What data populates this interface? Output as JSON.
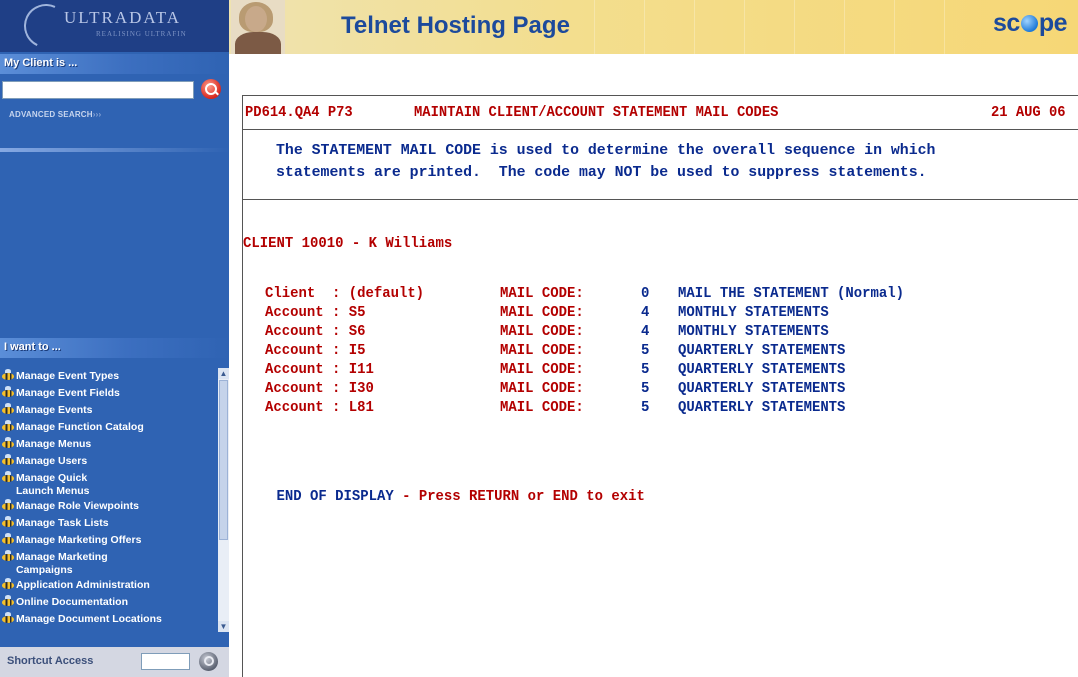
{
  "sidebar": {
    "logo": {
      "brand": "ULTRADATA",
      "tagline": "REALISING ULTRAFIN"
    },
    "client_section": {
      "title": "My Client is ..."
    },
    "client_search": {
      "value": "",
      "placeholder": ""
    },
    "advanced_search": {
      "label": "ADVANCED SEARCH",
      "arrows": "›››"
    },
    "i_want_to": {
      "title": "I want to ..."
    },
    "menu_items": [
      {
        "label": "Manage Event Types"
      },
      {
        "label": "Manage Event Fields"
      },
      {
        "label": "Manage Events"
      },
      {
        "label": "Manage Function Catalog"
      },
      {
        "label": "Manage Menus"
      },
      {
        "label": "Manage Users"
      },
      {
        "label": "Manage Quick Launch Menus"
      },
      {
        "label": "Manage Role Viewpoints"
      },
      {
        "label": "Manage Task Lists"
      },
      {
        "label": "Manage Marketing Offers"
      },
      {
        "label": "Manage Marketing Campaigns"
      },
      {
        "label": "Application Administration"
      },
      {
        "label": "Online Documentation"
      },
      {
        "label": "Manage Document Locations"
      }
    ],
    "shortcut": {
      "label": "Shortcut Access",
      "value": ""
    }
  },
  "banner": {
    "title": "Telnet Hosting Page",
    "logo_left": "sc",
    "logo_right": "pe"
  },
  "terminal": {
    "program_id": "PD614.QA4 P73",
    "screen_title": "MAINTAIN CLIENT/ACCOUNT STATEMENT MAIL CODES",
    "date": "21 AUG 06",
    "intro_line1": "The STATEMENT MAIL CODE is used to determine the overall sequence in which",
    "intro_line2": "statements are printed.  The code may NOT be used to suppress statements.",
    "client_line": "CLIENT 10010 - K Williams",
    "rows": [
      {
        "entity": "Client  : (default)",
        "code_label": "MAIL CODE:",
        "code": "0",
        "description": "MAIL THE STATEMENT (Normal)"
      },
      {
        "entity": "Account : S5",
        "code_label": "MAIL CODE:",
        "code": "4",
        "description": "MONTHLY STATEMENTS"
      },
      {
        "entity": "Account : S6",
        "code_label": "MAIL CODE:",
        "code": "4",
        "description": "MONTHLY STATEMENTS"
      },
      {
        "entity": "Account : I5",
        "code_label": "MAIL CODE:",
        "code": "5",
        "description": "QUARTERLY STATEMENTS"
      },
      {
        "entity": "Account : I11",
        "code_label": "MAIL CODE:",
        "code": "5",
        "description": "QUARTERLY STATEMENTS"
      },
      {
        "entity": "Account : I30",
        "code_label": "MAIL CODE:",
        "code": "5",
        "description": "QUARTERLY STATEMENTS"
      },
      {
        "entity": "Account : L81",
        "code_label": "MAIL CODE:",
        "code": "5",
        "description": "QUARTERLY STATEMENTS"
      }
    ],
    "end_prefix": "END OF DISPLAY",
    "end_suffix": " - Press RETURN or END to exit"
  },
  "colors": {
    "sidebar_blue": "#2f63b3",
    "banner_gold": "#f3de8e",
    "terminal_red": "#b30000",
    "terminal_blue": "#0a2a8e"
  },
  "icons": {
    "search": "search-icon",
    "shortcut_go": "shortcut-go-icon",
    "menu_bullet": "bee-icon",
    "logo": "scope-logo"
  }
}
